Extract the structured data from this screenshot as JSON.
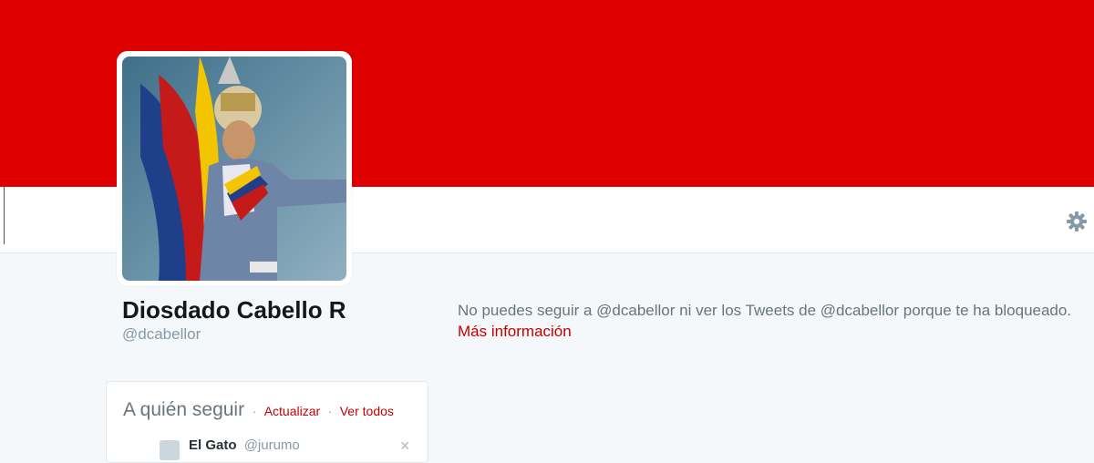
{
  "profile": {
    "name": "Diosdado Cabello R",
    "handle": "@dcabellor",
    "avatar_alt": "profile photo"
  },
  "header": {
    "banner_color": "#de0000",
    "settings_icon": "gear-icon"
  },
  "blocked": {
    "message": "No puedes seguir a @dcabellor ni ver los Tweets de @dcabellor porque te ha bloqueado.",
    "more_info_label": "Más información"
  },
  "who_to_follow": {
    "title": "A quién seguir",
    "refresh_label": "Actualizar",
    "view_all_label": "Ver todos",
    "separator": "·",
    "suggestions": [
      {
        "name": "El Gato",
        "handle": "@jurumo",
        "dismiss_label": "×"
      }
    ]
  },
  "colors": {
    "accent": "#c40000",
    "muted": "#66757f",
    "background": "#f5f8fa"
  }
}
